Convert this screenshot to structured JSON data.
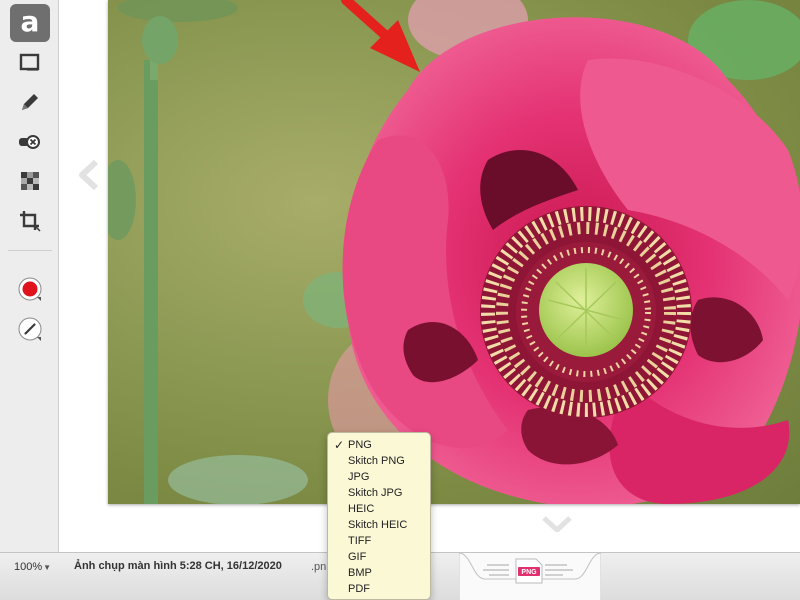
{
  "toolbar": {
    "tools": [
      {
        "name": "text-tool",
        "label": "a",
        "icon": "text-icon"
      },
      {
        "name": "rectangle-tool",
        "icon": "rectangle-icon"
      },
      {
        "name": "pencil-tool",
        "icon": "pencil-icon"
      },
      {
        "name": "eraser-tool",
        "icon": "eraser-icon"
      },
      {
        "name": "pixelate-tool",
        "icon": "pixelate-icon"
      },
      {
        "name": "crop-tool",
        "icon": "crop-icon"
      },
      {
        "name": "color-picker",
        "icon": "color-dot-icon",
        "color": "#e0121b"
      },
      {
        "name": "line-width-picker",
        "icon": "line-width-icon"
      }
    ]
  },
  "status": {
    "zoom": "100%",
    "filename": "Ảnh chụp màn hình 5:28 CH, 16/12/2020",
    "extension_hint": ".pn",
    "drag_badge": "PNG"
  },
  "format_menu": {
    "selected": "PNG",
    "options": [
      "PNG",
      "Skitch PNG",
      "JPG",
      "Skitch JPG",
      "HEIC",
      "Skitch HEIC",
      "TIFF",
      "GIF",
      "BMP",
      "PDF"
    ]
  },
  "colors": {
    "annotation_arrow": "#e4211c",
    "flower_petal": "#e0306f",
    "flower_center": "#b9d96a"
  }
}
